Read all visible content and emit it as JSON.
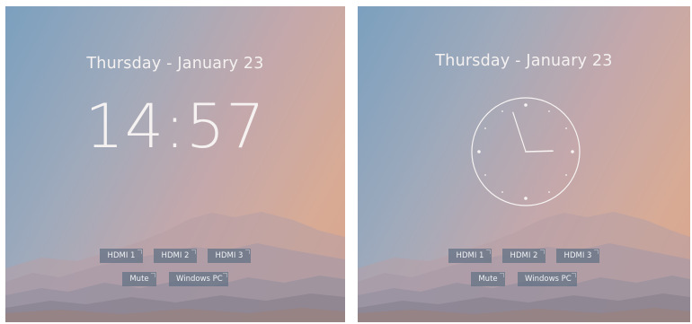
{
  "screens": [
    {
      "date": "Thursday - January 23",
      "time": "14:57",
      "clock_style": "digital",
      "inputs": [
        "HDMI 1",
        "HDMI 2",
        "HDMI 3"
      ],
      "actions": [
        "Mute",
        "Windows PC"
      ]
    },
    {
      "date": "Thursday - January 23",
      "time": "14:57",
      "clock_style": "analog",
      "inputs": [
        "HDMI 1",
        "HDMI 2",
        "HDMI 3"
      ],
      "actions": [
        "Mute",
        "Windows PC"
      ]
    }
  ],
  "colors": {
    "text": "#f4f1f0",
    "button_bg": "#607084",
    "sky_top": "#7ba0bf",
    "sky_warm": "#dca48a"
  },
  "icons": [
    "mountains-background",
    "analog-clock-icon"
  ]
}
